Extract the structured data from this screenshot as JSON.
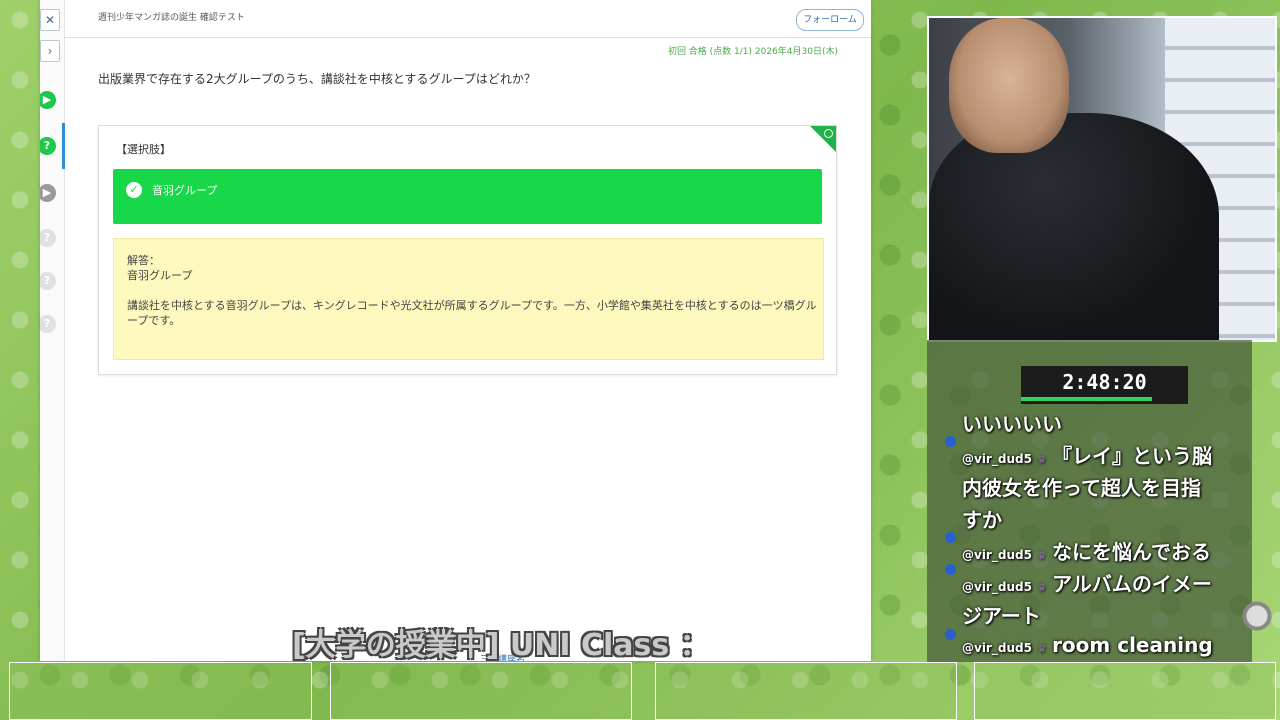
{
  "browser": {
    "header_title": "週刊少年マンガ誌の誕生 確認テスト",
    "follow_button": "フォーローム",
    "result_meta": "初回 合格 (点数 1/1) 2026年4月30日(木)",
    "question": "出版業界で存在する2大グループのうち、講談社を中核とするグループはどれか？",
    "choices_label": "【選択肢】",
    "correct_choice": "音羽グループ",
    "answer_title": "解答：",
    "answer_value": "音羽グループ",
    "explanation": "講談社を中核とする音羽グループは、キングレコードや光文社が所属するグループです。一方、小学館や集英社を中核とするのは一ツ橋グループです。",
    "bottom_link": "三学講座名",
    "correct_color": "#18d84a",
    "answer_bg": "#fdf8bd"
  },
  "stream": {
    "timer": "2:48:20",
    "caption": "[大学の授業中] UNI Class ：",
    "chat": [
      {
        "user": "",
        "text": "いいいいい"
      },
      {
        "user": "@vir_dud5",
        "text": "『レイ』という脳"
      },
      {
        "user": "",
        "text": "内彼女を作って超人を目指"
      },
      {
        "user": "",
        "text": "すか"
      },
      {
        "user": "@vir_dud5",
        "text": "なにを悩んでおる"
      },
      {
        "user": "@vir_dud5",
        "text": "アルバムのイメー"
      },
      {
        "user": "",
        "text": "ジアート"
      },
      {
        "user": "@vir_dud5",
        "text": "room cleaning"
      }
    ]
  }
}
